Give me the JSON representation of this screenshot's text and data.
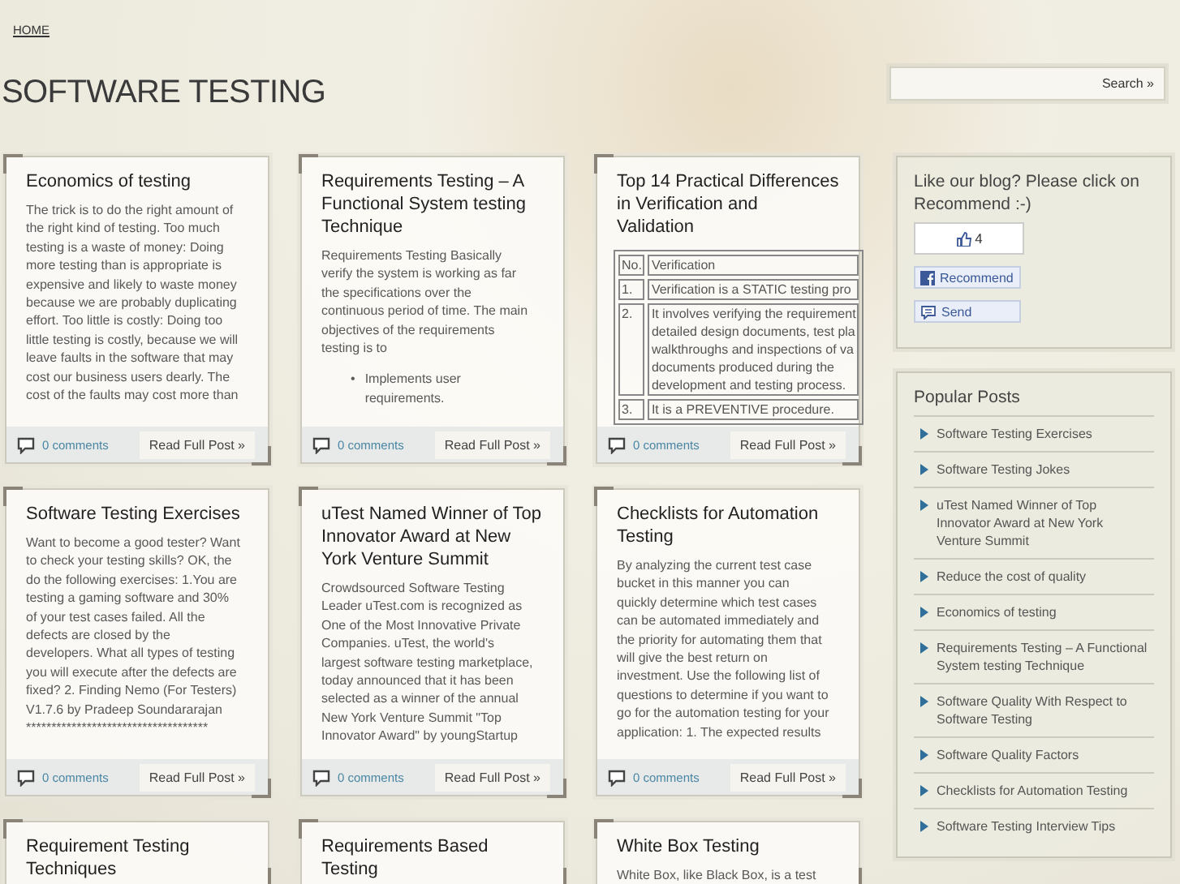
{
  "nav": {
    "home": "HOME"
  },
  "blog_title": "SOFTWARE TESTING",
  "search": {
    "button": "Search »"
  },
  "posts": [
    {
      "kind": "text",
      "title": "Economics of testing",
      "lines": [
        "The trick is to do the right amount of",
        "the right kind of testing. Too much",
        "testing is a waste of money: Doing",
        "more testing than is appropriate is",
        "expensive and likely to waste money",
        "because we are probably duplicating",
        "effort. Too little is costly: Doing too",
        "little testing is costly, because we will",
        "leave faults in the software that may",
        "cost our business users dearly. The",
        "cost of the faults may cost more than"
      ],
      "comments": "0 comments",
      "read_more": "Read Full Post »"
    },
    {
      "kind": "text",
      "title": "Requirements Testing – A Functional System testing Technique",
      "lines": [
        "Requirements Testing Basically",
        "verify the system is working as far",
        "the specifications over the",
        "continuous period of time. The main",
        "objectives of the requirements",
        "testing is to"
      ],
      "bullets": [
        {
          "marker": "•",
          "lines": [
            "Implements user",
            "requirements."
          ]
        }
      ],
      "comments": "0 comments",
      "read_more": "Read Full Post »"
    },
    {
      "kind": "table",
      "title": "Top 14 Practical Differences in Verification and Validation",
      "table": [
        {
          "no": "No.",
          "lines": [
            "Verification"
          ]
        },
        {
          "no": "1.",
          "lines": [
            "Verification is a STATIC testing pro"
          ]
        },
        {
          "no": "2.",
          "lines": [
            "It involves verifying the requirement",
            "detailed design documents, test pla",
            "walkthroughs and inspections of va",
            "documents produced during the",
            "development and testing process."
          ]
        },
        {
          "no": "3.",
          "lines": [
            "It is a PREVENTIVE procedure."
          ]
        }
      ],
      "comments": "0 comments",
      "read_more": "Read Full Post »"
    },
    {
      "kind": "text",
      "title": "Software Testing Exercises",
      "lines": [
        "Want to become a good tester? Want",
        "to check your testing skills? OK, the",
        "do the following exercises: 1.You are",
        "testing a gaming software and 30%",
        "of your test cases failed. All the",
        "defects are closed by the",
        "developers. What all types of testing",
        "you will execute after the defects are",
        "fixed? 2. Finding Nemo (For Testers)",
        "V1.7.6 by Pradeep Soundararajan",
        "************************************"
      ],
      "comments": "0 comments",
      "read_more": "Read Full Post »"
    },
    {
      "kind": "text",
      "title": "uTest Named Winner of Top Innovator Award at New York Venture Summit",
      "lines": [
        "Crowdsourced Software Testing",
        "Leader uTest.com is recognized as",
        "One of the Most Innovative Private",
        "Companies. uTest, the world's",
        "largest software testing marketplace,",
        "today announced that it has been",
        "selected as a winner of the annual",
        "New York Venture Summit \"Top",
        "Innovator Award\" by youngStartup"
      ],
      "comments": "0 comments",
      "read_more": "Read Full Post »"
    },
    {
      "kind": "text",
      "title": "Checklists for Automation Testing",
      "lines": [
        "By analyzing the current test case",
        "bucket in this manner you can",
        "quickly determine which test cases",
        "can be automated immediately and",
        "the priority for automating them that",
        "will give the best return on",
        "investment. Use the following list of",
        "questions to determine if you want to",
        "go for the automation testing for your",
        "application: 1. The expected results"
      ],
      "comments": "0 comments",
      "read_more": "Read Full Post »"
    },
    {
      "kind": "text",
      "title": "Requirement Testing Techniques"
    },
    {
      "kind": "text",
      "title": "Requirements Based Testing"
    },
    {
      "kind": "text",
      "title": "White Box Testing",
      "lines": [
        "White Box, like Black Box, is a test"
      ]
    }
  ],
  "sidebar": {
    "like_widget": {
      "heading": "Like our blog? Please click on Recommend :-)",
      "count": "4",
      "recommend": "Recommend",
      "send": "Send"
    },
    "popular_posts": {
      "heading": "Popular Posts",
      "items": [
        "Software Testing Exercises",
        "Software Testing Jokes",
        "uTest Named Winner of Top Innovator Award at New York Venture Summit",
        "Reduce the cost of quality",
        "Economics of testing",
        "Requirements Testing – A Functional System testing Technique",
        "Software Quality With Respect to Software Testing",
        "Software Quality Factors",
        "Checklists for Automation Testing",
        "Software Testing Interview Tips"
      ]
    }
  }
}
